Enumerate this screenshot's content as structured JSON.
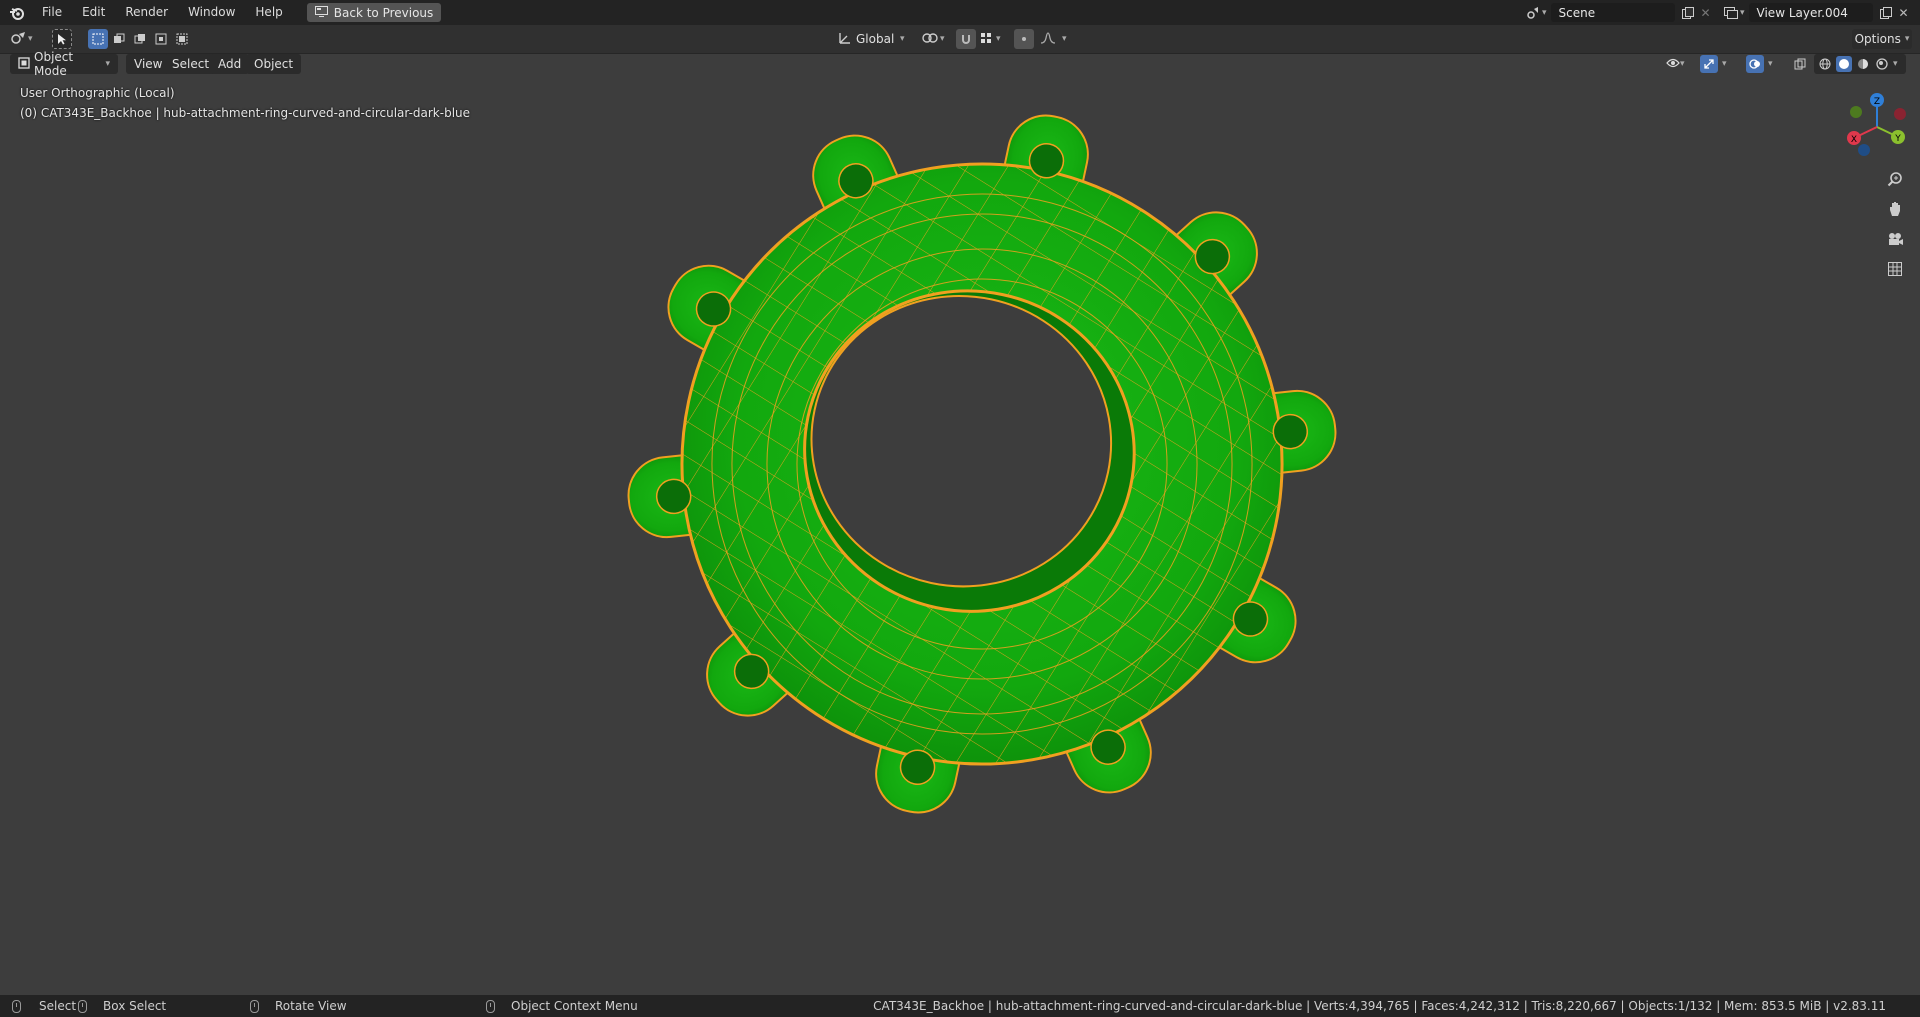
{
  "menu": {
    "file": "File",
    "edit": "Edit",
    "render": "Render",
    "window": "Window",
    "help": "Help",
    "back_button": "Back to Previous"
  },
  "scene": {
    "name": "Scene",
    "view_layer": "View Layer.004"
  },
  "tool_header": {
    "transform_orientation": "Global",
    "options_label": "Options"
  },
  "view_header": {
    "mode": "Object Mode",
    "view": "View",
    "select": "Select",
    "add": "Add",
    "object": "Object"
  },
  "viewport": {
    "view_name": "User Orthographic (Local)",
    "object_info": "(0) CAT343E_Backhoe | hub-attachment-ring-curved-and-circular-dark-blue",
    "gizmo": {
      "z": "Z",
      "y": "Y",
      "x": "X"
    }
  },
  "status": {
    "select": "Select",
    "box_select": "Box Select",
    "rotate_view": "Rotate View",
    "context_menu": "Object Context Menu",
    "stats": "CAT343E_Backhoe | hub-attachment-ring-curved-and-circular-dark-blue | Verts:4,394,765 | Faces:4,242,312 | Tris:8,220,667 | Objects:1/132 | Mem: 853.5 MiB | v2.83.11"
  },
  "colors": {
    "mesh_fill": "#12a80e",
    "wire": "#f0a020",
    "background": "#3d3d3d",
    "accent": "#4772b3"
  }
}
